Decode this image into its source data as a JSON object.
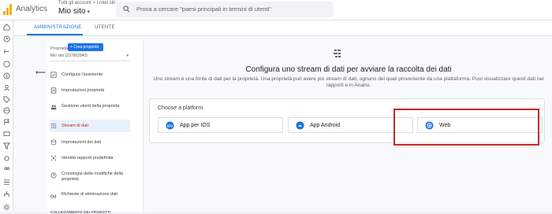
{
  "header": {
    "app_name": "Analytics",
    "breadcrumb": "Tutti gli account > I miei siti",
    "property_name": "Mio sito",
    "search_placeholder": "Prova a cercare \"paesi principali in termini di utenti\""
  },
  "tabs": {
    "admin": "AMMINISTRAZIONE",
    "user": "UTENTE"
  },
  "property_panel": {
    "label": "Proprietà",
    "create_button": "+ Crea proprietà",
    "selected": "Mio sito (297862840)"
  },
  "nav": [
    {
      "label": "Configura l'assistente",
      "icon": "checkbox-icon"
    },
    {
      "label": "Impostazioni proprietà",
      "icon": "settings-doc-icon"
    },
    {
      "label": "Gestione utenti della proprietà",
      "icon": "people-icon"
    },
    {
      "label": "Stream di dati",
      "icon": "data-stream-icon"
    },
    {
      "label": "Impostazioni dei dati",
      "icon": "database-icon"
    },
    {
      "label": "Identità rapporti predefinita",
      "icon": "identity-icon"
    },
    {
      "label": "Cronologia delle modifiche della proprietà",
      "icon": "history-icon"
    },
    {
      "label": "Richieste di eliminazione dati",
      "icon": "delete-data-icon"
    }
  ],
  "nav_section": "COLLEGAMENTO DEI PRODOTTI",
  "main": {
    "title": "Configura uno stream di dati per avviare la raccolta dei dati",
    "description": "Uno stream è una fonte di dati per la proprietà. Una proprietà può avere più stream di dati, ognuno dei quali proveniente da una piattaforma. Puoi visualizzare questi dati nei rapporti e in Analisi.",
    "choose_label": "Choose a platform",
    "platforms": [
      {
        "label": "App per IOS",
        "icon": "ios-icon"
      },
      {
        "label": "App Android",
        "icon": "android-icon"
      },
      {
        "label": "Web",
        "icon": "web-globe-icon"
      }
    ]
  },
  "colors": {
    "accent": "#1a73e8",
    "highlight": "#c62828",
    "brand": "#f9ab00"
  }
}
